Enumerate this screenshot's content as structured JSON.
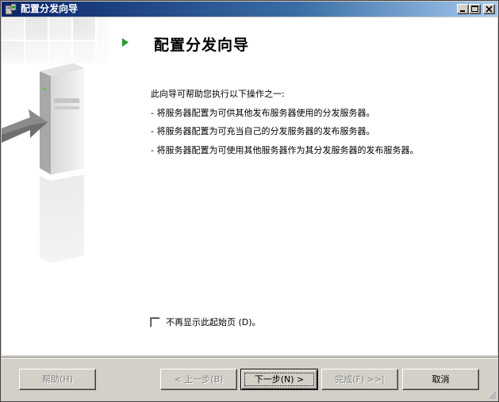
{
  "window": {
    "title": "配置分发向导"
  },
  "page": {
    "heading": "配置分发向导",
    "intro": "此向导可帮助您执行以下操作之一:",
    "bullets": [
      "- 将服务器配置为可供其他发布服务器使用的分发服务器。",
      "- 将服务器配置为可充当自己的分发服务器的发布服务器。",
      "- 将服务器配置为可使用其他服务器作为其分发服务器的发布服务器。"
    ],
    "checkbox_label": "不再显示此起始页 (D)。",
    "checkbox_checked": false
  },
  "buttons": {
    "help": "帮助(H)",
    "prev": "< 上一步(B)",
    "next": "下一步(N) >",
    "finish": "完成(F) >>|",
    "cancel": "取消"
  },
  "icons": {
    "title": "wizard-app-icon",
    "heading": "green-play-icon",
    "minimize": "minimize-icon",
    "maximize": "maximize-icon",
    "close": "close-icon",
    "grip": "resize-grip-icon"
  },
  "colors": {
    "title_bar_start": "#0a246a",
    "title_bar_end": "#a6caf0",
    "accent_green": "#2e9a2e",
    "dialog_face": "#d4d0c8"
  }
}
